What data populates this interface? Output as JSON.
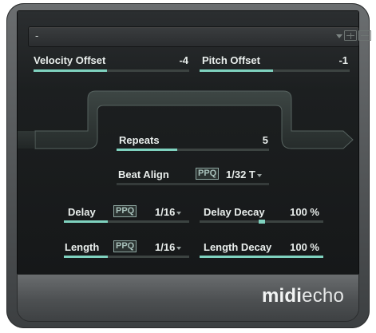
{
  "preset": {
    "name": "-"
  },
  "params": {
    "velocity_offset": {
      "label": "Velocity Offset",
      "value": "-4",
      "level": 0.47
    },
    "pitch_offset": {
      "label": "Pitch Offset",
      "value": "-1",
      "level": 0.49
    },
    "repeats": {
      "label": "Repeats",
      "value": "5",
      "level": 0.4
    },
    "beat_align": {
      "label": "Beat Align",
      "ppq": "PPQ",
      "value": "1/32 T"
    },
    "delay": {
      "label": "Delay",
      "ppq": "PPQ",
      "value": "1/16",
      "level": 0.35
    },
    "delay_decay": {
      "label": "Delay Decay",
      "value": "100 %",
      "level": 0.5
    },
    "length": {
      "label": "Length",
      "ppq": "PPQ",
      "value": "1/16",
      "level": 0.35
    },
    "length_decay": {
      "label": "Length Decay",
      "value": "100 %",
      "level": 1.0
    }
  },
  "brand": {
    "bold": "midi",
    "normal": "echo"
  },
  "colors": {
    "accent": "#7fd2bf",
    "panel": "#1c1f20",
    "route": "#36403e"
  },
  "icons": [
    "dropdown-arrow-icon",
    "preset-save-icon",
    "preset-load-icon"
  ]
}
